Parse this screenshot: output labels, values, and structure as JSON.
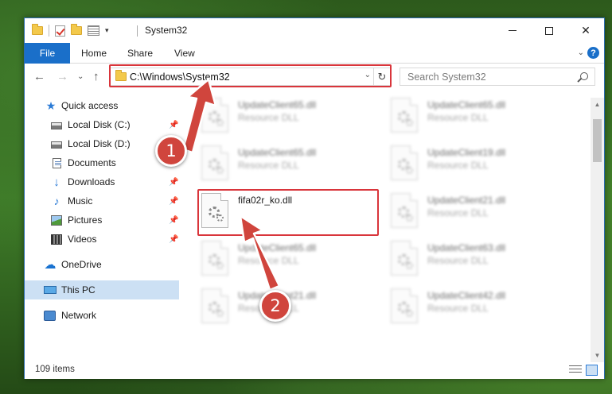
{
  "window": {
    "title": "System32",
    "minimize_icon": "minimize-icon",
    "maximize_icon": "maximize-icon",
    "close_glyph": "✕"
  },
  "ribbon": {
    "tabs": [
      {
        "label": "File"
      },
      {
        "label": "Home"
      },
      {
        "label": "Share"
      },
      {
        "label": "View"
      }
    ],
    "expand_glyph": "⌄",
    "help_glyph": "?"
  },
  "navigation": {
    "back_glyph": "←",
    "forward_glyph": "→",
    "recent_glyph": "⌄",
    "up_glyph": "↑"
  },
  "address": {
    "path": "C:\\Windows\\System32",
    "dropdown_glyph": "⌄",
    "refresh_glyph": "↻"
  },
  "search": {
    "placeholder": "Search System32"
  },
  "sidebar": {
    "items": [
      {
        "label": "Quick access",
        "icon": "star-icon"
      },
      {
        "label": "Local Disk (C:)",
        "icon": "disk-icon",
        "pinned": true
      },
      {
        "label": "Local Disk (D:)",
        "icon": "disk-icon"
      },
      {
        "label": "Documents",
        "icon": "document-icon"
      },
      {
        "label": "Downloads",
        "icon": "download-icon",
        "pinned": true
      },
      {
        "label": "Music",
        "icon": "music-icon",
        "pinned": true
      },
      {
        "label": "Pictures",
        "icon": "pictures-icon",
        "pinned": true
      },
      {
        "label": "Videos",
        "icon": "videos-icon",
        "pinned": true
      },
      {
        "label": "OneDrive",
        "icon": "cloud-icon"
      },
      {
        "label": "This PC",
        "icon": "computer-icon",
        "selected": true
      },
      {
        "label": "Network",
        "icon": "network-icon"
      }
    ],
    "pin_glyph": "📌"
  },
  "files": [
    {
      "name": "UpdateClient65.dll",
      "type": "Resource DLL",
      "blurred": true
    },
    {
      "name": "UpdateClient65.dll",
      "type": "Resource DLL",
      "blurred": true
    },
    {
      "name": "UpdateClient65.dll",
      "type": "Resource DLL",
      "blurred": true
    },
    {
      "name": "UpdateClient19.dll",
      "type": "Resource DLL",
      "blurred": true
    },
    {
      "name": "fifa02r_ko.dll",
      "type": "",
      "blurred": false
    },
    {
      "name": "UpdateClient21.dll",
      "type": "Resource DLL",
      "blurred": true
    },
    {
      "name": "UpdateClient65.dll",
      "type": "Resource DLL",
      "blurred": true
    },
    {
      "name": "UpdateClient63.dll",
      "type": "Resource DLL",
      "blurred": true
    },
    {
      "name": "UpdateClient21.dll",
      "type": "Resource DLL",
      "blurred": true
    },
    {
      "name": "UpdateClient42.dll",
      "type": "Resource DLL",
      "blurred": true
    }
  ],
  "status": {
    "item_count": "109 items"
  },
  "annotations": {
    "badge_1": "1",
    "badge_2": "2",
    "highlight_color": "#d9353b"
  },
  "colors": {
    "accent": "#1a6fc9",
    "selection": "#cce0f4"
  }
}
